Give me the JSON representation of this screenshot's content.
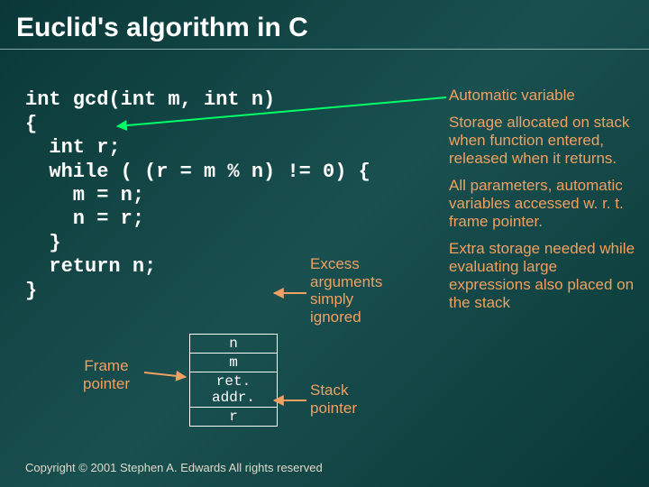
{
  "title": "Euclid's algorithm in C",
  "code": {
    "l1": "int gcd(int m, int n)",
    "l2": "{",
    "l3": "  int r;",
    "l4": "  while ( (r = m % n) != 0) {",
    "l5": "    m = n;",
    "l6": "    n = r;",
    "l7": "  }",
    "l8": "  return n;",
    "l9": "}"
  },
  "stack": {
    "c1": "n",
    "c2": "m",
    "c3": "ret. addr.",
    "c4": "r"
  },
  "frame_pointer": {
    "l1": "Frame",
    "l2": "pointer"
  },
  "stack_pointer": {
    "l1": "Stack",
    "l2": "pointer"
  },
  "excess": {
    "l1": "Excess",
    "l2": "arguments",
    "l3": "simply",
    "l4": "ignored"
  },
  "right": {
    "p1": "Automatic variable",
    "p2": "Storage allocated on stack when function entered, released when it returns.",
    "p3": "All parameters, automatic variables accessed w. r. t. frame pointer.",
    "p4": "Extra storage needed while evaluating large expressions also placed on the stack"
  },
  "copyright": "Copyright © 2001 Stephen A. Edwards  All rights reserved"
}
